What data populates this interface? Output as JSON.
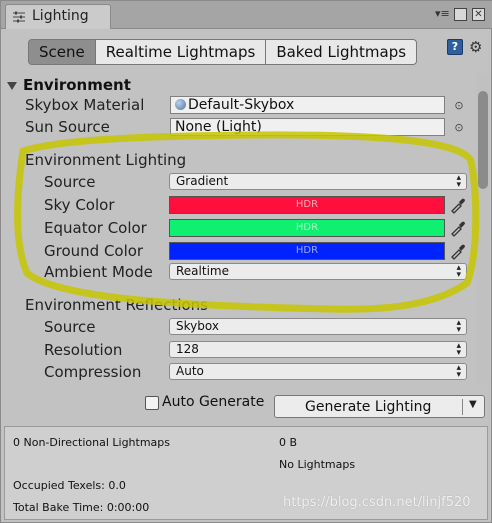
{
  "window": {
    "tab_title": "Lighting",
    "controls": {
      "menu": "▾≡",
      "maximize": "□",
      "close": "✕"
    }
  },
  "modes": [
    {
      "label": "Scene",
      "active": true
    },
    {
      "label": "Realtime Lightmaps",
      "active": false
    },
    {
      "label": "Baked Lightmaps",
      "active": false
    }
  ],
  "environment": {
    "header": "Environment",
    "skybox_material_label": "Skybox Material",
    "skybox_material_value": "Default-Skybox",
    "sun_source_label": "Sun Source",
    "sun_source_value": "None (Light)",
    "lighting_header": "Environment Lighting",
    "source_label": "Source",
    "source_value": "Gradient",
    "sky_color_label": "Sky Color",
    "equator_color_label": "Equator Color",
    "ground_color_label": "Ground Color",
    "hdr_text": "HDR",
    "ambient_mode_label": "Ambient Mode",
    "ambient_mode_value": "Realtime",
    "colors": {
      "sky": "#ff0f3c",
      "equator": "#0ff070",
      "ground": "#0022ff"
    }
  },
  "reflections": {
    "header": "Environment Reflections",
    "source_label": "Source",
    "source_value": "Skybox",
    "resolution_label": "Resolution",
    "resolution_value": "128",
    "compression_label": "Compression",
    "compression_value": "Auto"
  },
  "bake": {
    "auto_generate_label": "Auto Generate",
    "auto_generate_checked": false,
    "generate_label": "Generate Lighting"
  },
  "stats": {
    "non_directional": "0 Non-Directional Lightmaps",
    "size": "0 B",
    "no_lightmaps": "No Lightmaps",
    "occupied_texels": "Occupied Texels: 0.0",
    "total_bake_time": "Total Bake Time: 0:00:00"
  },
  "watermark": "https://blog.csdn.net/linjf520",
  "highlight_color": "#c6c600"
}
